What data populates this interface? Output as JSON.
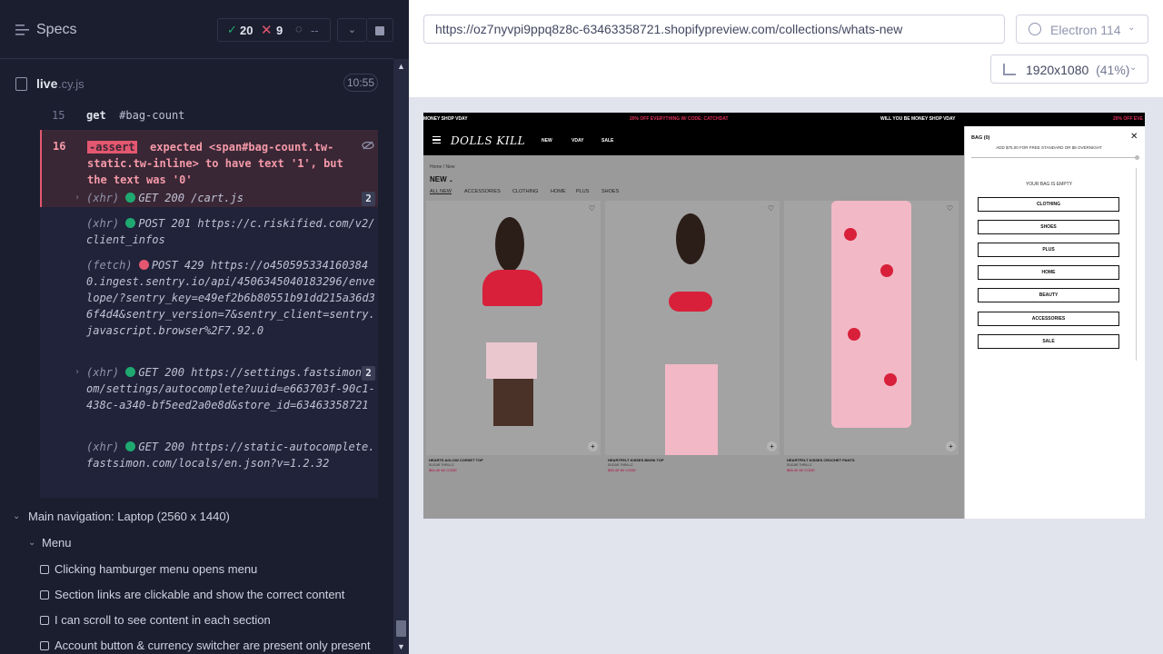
{
  "runner": {
    "specs_label": "Specs",
    "stats": {
      "passed": "20",
      "failed": "9",
      "pending": "--"
    },
    "file": {
      "name": "live",
      "ext": ".cy.js",
      "duration": "10:55"
    }
  },
  "log": {
    "line15": {
      "num": "15",
      "cmd": "get",
      "arg": "#bag-count"
    },
    "line16": {
      "num": "16",
      "assert_tag": "-assert",
      "message": "expected <span#bag-count.tw-static.tw-inline> to have text '1', but the text was '0'"
    },
    "entries": [
      {
        "kind": "(xhr)",
        "dot": "green",
        "text": "GET 200 /cart.js",
        "count": "2",
        "expandable": true
      },
      {
        "kind": "(xhr)",
        "dot": "green",
        "text": "POST 201 https://c.riskified.com/v2/client_infos",
        "count": "",
        "expandable": false
      },
      {
        "kind": "(fetch)",
        "dot": "red",
        "text": "POST 429 https://o4505953341603840.ingest.sentry.io/api/4506345040183296/envelope/?sentry_key=e49ef2b6b80551b91dd215a36d36f4d4&sentry_version=7&sentry_client=sentry.javascript.browser%2F7.92.0",
        "count": "",
        "expandable": false
      },
      {
        "kind": "(xhr)",
        "dot": "green",
        "text": "GET 200 https://settings.fastsimon.com/settings/autocomplete?uuid=e663703f-90c1-438c-a340-bf5eed2a0e8d&store_id=63463358721",
        "count": "2",
        "expandable": true
      },
      {
        "kind": "(xhr)",
        "dot": "green",
        "text": "GET 200 https://static-autocomplete.fastsimon.com/locals/en.json?v=1.2.32",
        "count": "",
        "expandable": false
      }
    ]
  },
  "tree": {
    "suite": "Main navigation: Laptop (2560 x 1440)",
    "subsuite": "Menu",
    "tests": [
      "Clicking hamburger menu opens menu",
      "Section links are clickable and show the correct content",
      "I can scroll to see content in each section",
      "Account button & currency switcher are present only present"
    ]
  },
  "browser": {
    "url": "https://oz7nyvpi9ppq8z8c-63463358721.shopifypreview.com/collections/whats-new",
    "name": "Electron 114",
    "viewport": "1920x1080",
    "scale": "(41%)"
  },
  "site": {
    "promo": [
      "MONEY SHOP VDAY",
      "20% OFF EVERYTHING W/ CODE: CATCHDAT",
      "WILL YOU BE MONEY SHOP VDAY",
      "20% OFF EVE"
    ],
    "logo": "DOLLS KILL",
    "nav": [
      "NEW",
      "VDAY",
      "SALE"
    ],
    "breadcrumb": "Home / New",
    "heading": "NEW",
    "filters": [
      "ALL NEW",
      "ACCESSORIES",
      "CLOTHING",
      "HOME",
      "PLUS",
      "SHOES"
    ],
    "products": [
      {
        "name": "HEARTS AGLOW CORSET TOP",
        "brand": "SUGAR THRILLZ",
        "price": "$54.40 W/ CODE"
      },
      {
        "name": "HEARTFELT KISSES BIKINI TOP",
        "brand": "SUGAR THRILLZ",
        "price": "$30.40 W/ CODE"
      },
      {
        "name": "HEARTFELT KISSES CROCHET PANTS",
        "brand": "SUGAR THRILLZ",
        "price": "$55.40 W/ CODE"
      }
    ],
    "bag": {
      "title": "BAG (0)",
      "shipping": "ADD $75.00 FOR FREE STANDARD OR $8 OVERNIGHT",
      "empty": "YOUR BAG IS EMPTY",
      "categories": [
        "CLOTHING",
        "SHOES",
        "PLUS",
        "HOME",
        "BEAUTY",
        "ACCESSORIES",
        "SALE"
      ]
    }
  }
}
